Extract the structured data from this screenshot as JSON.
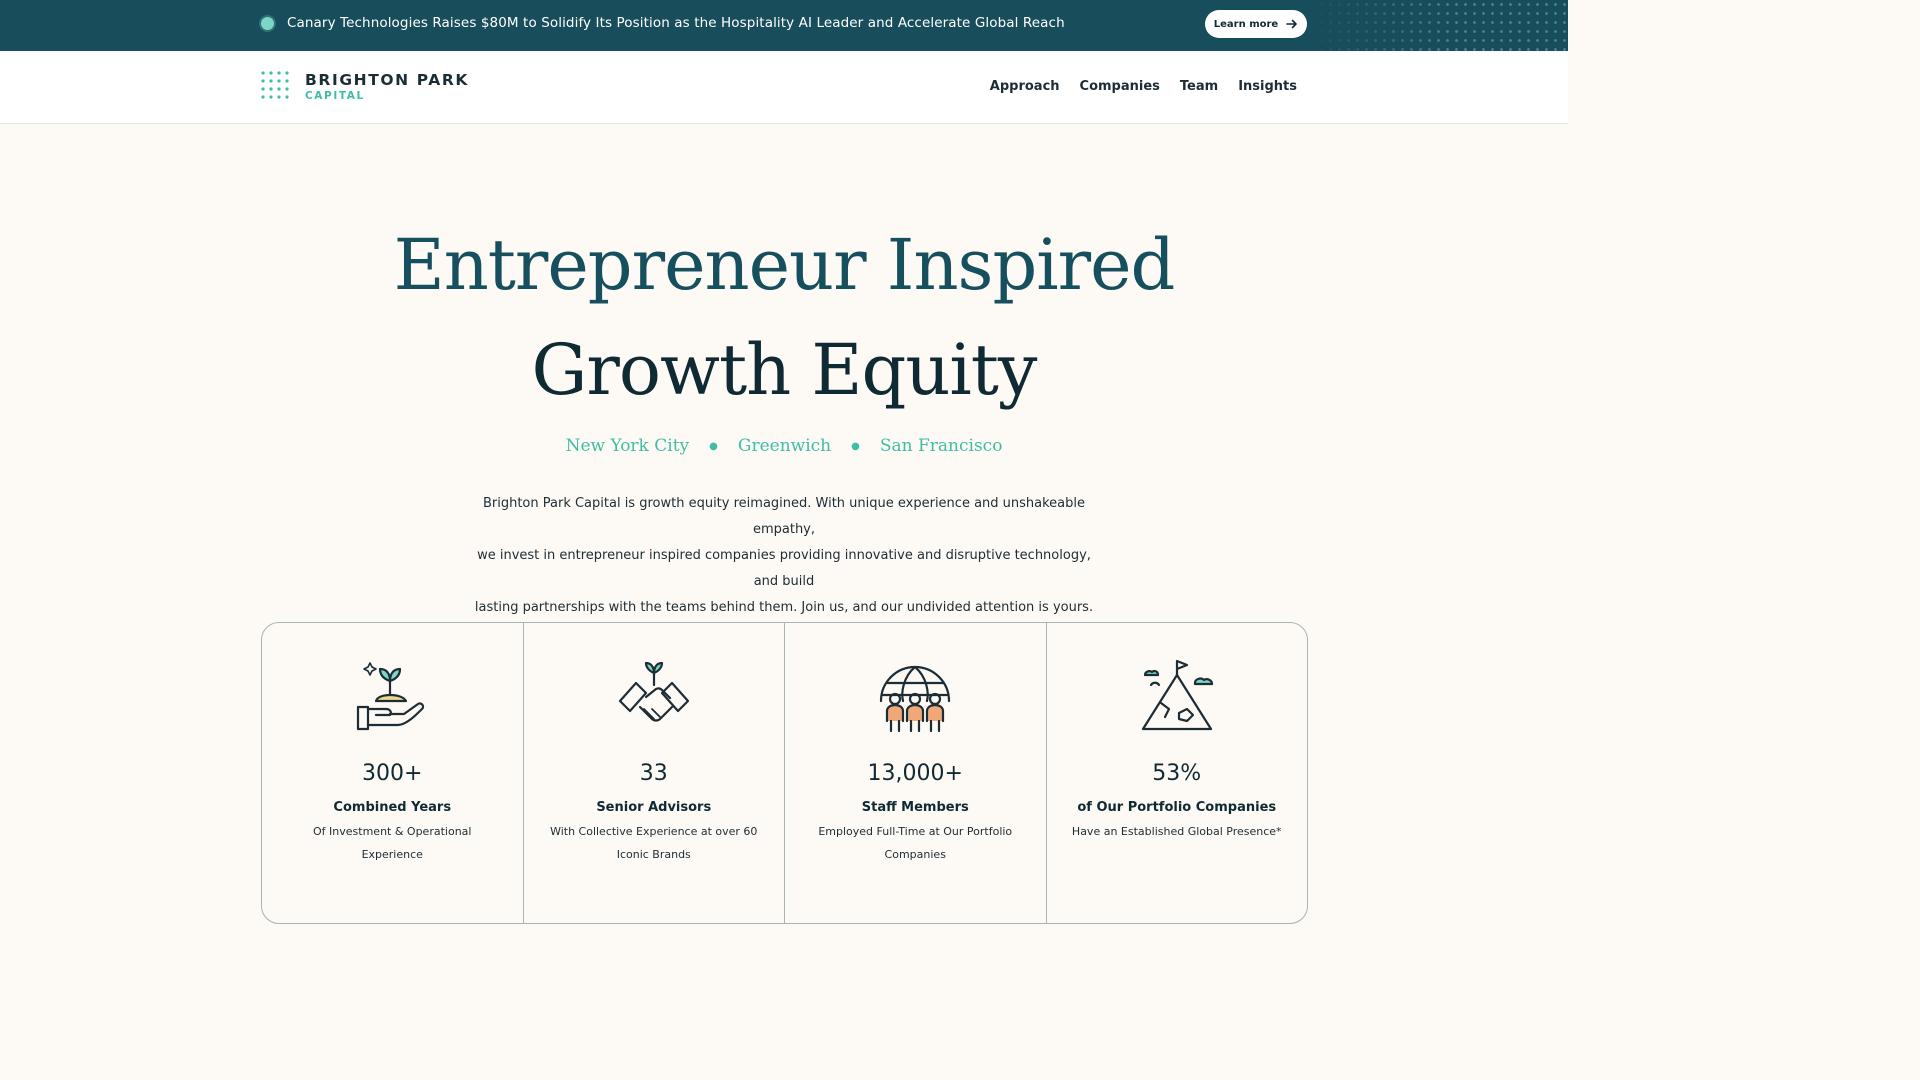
{
  "announcement": {
    "text": "Canary Technologies Raises $80M to Solidify Its Position as the Hospitality AI Leader and Accelerate Global Reach",
    "button_label": "Learn more",
    "bullet_color": "#7dd6c4"
  },
  "brand": {
    "name_line1": "BRIGHTON PARK",
    "name_line2": "CAPITAL",
    "accent_color": "#3dbfa4",
    "primary_color": "#164f5d"
  },
  "nav": {
    "items": [
      {
        "label": "Approach"
      },
      {
        "label": "Companies"
      },
      {
        "label": "Team"
      },
      {
        "label": "Insights"
      }
    ]
  },
  "hero": {
    "title_line1": "Entrepreneur Inspired",
    "title_line2": "Growth Equity",
    "cities": [
      "New York City",
      "Greenwich",
      "San Francisco"
    ],
    "intro_line1": "Brighton Park Capital is growth equity reimagined. With unique experience and unshakeable empathy,",
    "intro_line2": "we invest in entrepreneur inspired companies providing innovative and disruptive technology, and build",
    "intro_line3": "lasting partnerships with the teams behind them. Join us, and our undivided attention is yours."
  },
  "stats": [
    {
      "icon": "sprout-in-hand-icon",
      "value": "300+",
      "label": "Combined Years",
      "description": "Of Investment & Operational Experience"
    },
    {
      "icon": "handshake-sprout-icon",
      "value": "33",
      "label": "Senior Advisors",
      "description": "With Collective Experience at over 60 Iconic Brands"
    },
    {
      "icon": "globe-people-icon",
      "value": "13,000+",
      "label": "Staff Members",
      "description": "Employed Full-Time at Our Portfolio Companies"
    },
    {
      "icon": "mountain-flag-icon",
      "value": "53%",
      "label": "of Our Portfolio Companies",
      "description": "Have an Established Global Presence*"
    }
  ]
}
